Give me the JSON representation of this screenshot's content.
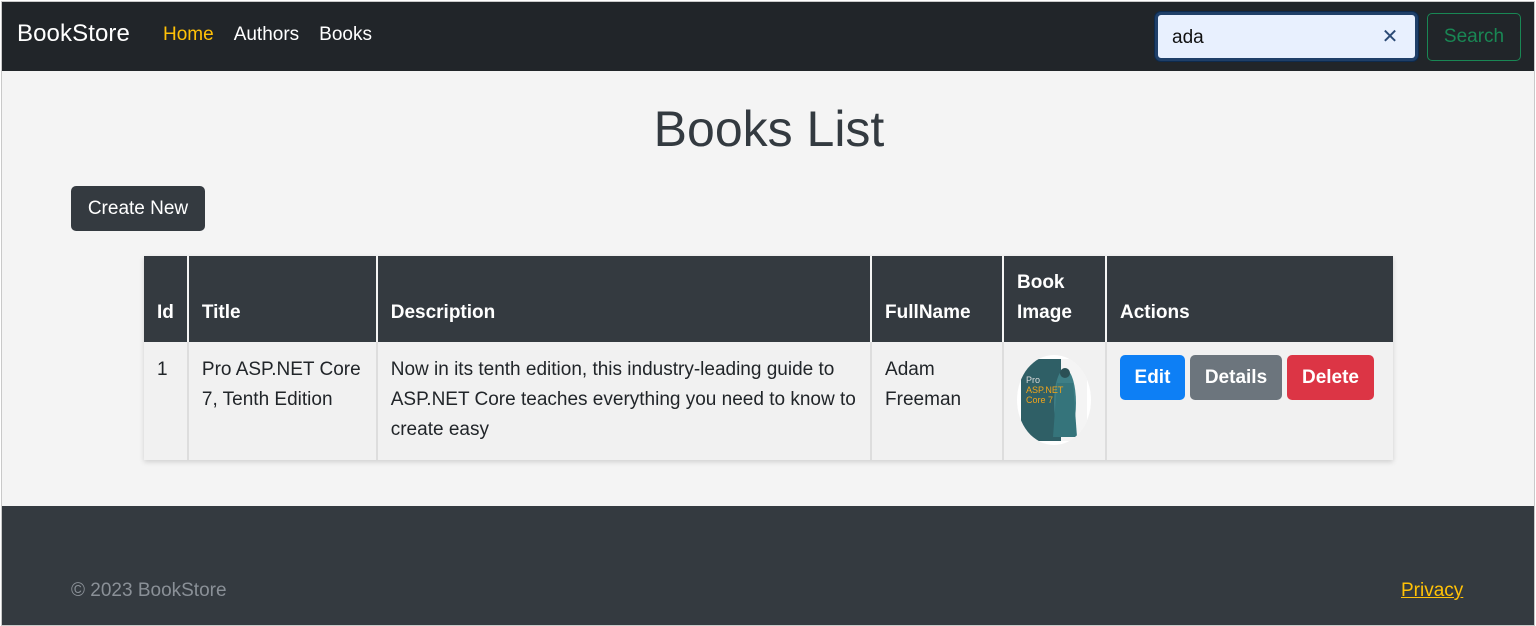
{
  "navbar": {
    "brand": "BookStore",
    "links": [
      {
        "label": "Home",
        "active": true
      },
      {
        "label": "Authors",
        "active": false
      },
      {
        "label": "Books",
        "active": false
      }
    ],
    "search": {
      "value": "ada",
      "button_label": "Search"
    }
  },
  "main": {
    "title": "Books List",
    "create_button": "Create New",
    "table": {
      "headers": [
        "Id",
        "Title",
        "Description",
        "FullName",
        "Book Image",
        "Actions"
      ],
      "rows": [
        {
          "id": "1",
          "title": "Pro ASP.NET Core 7, Tenth Edition",
          "description": "Now in its tenth edition, this industry-leading guide to ASP.NET Core teaches everything you need to know to create easy",
          "full_name": "Adam Freeman",
          "image_icon": "book-cover-image",
          "cover_text": [
            "Pro",
            "ASP.NET",
            "Core 7"
          ],
          "actions": {
            "edit": "Edit",
            "details": "Details",
            "delete": "Delete"
          }
        }
      ]
    }
  },
  "footer": {
    "copyright": "© 2023 BookStore",
    "privacy": "Privacy"
  },
  "colors": {
    "navbar": "#212529",
    "active_link": "#ffc107",
    "search_outline": "#198754",
    "edit": "#0d7ff5",
    "details": "#6c757d",
    "delete": "#dc3545"
  }
}
